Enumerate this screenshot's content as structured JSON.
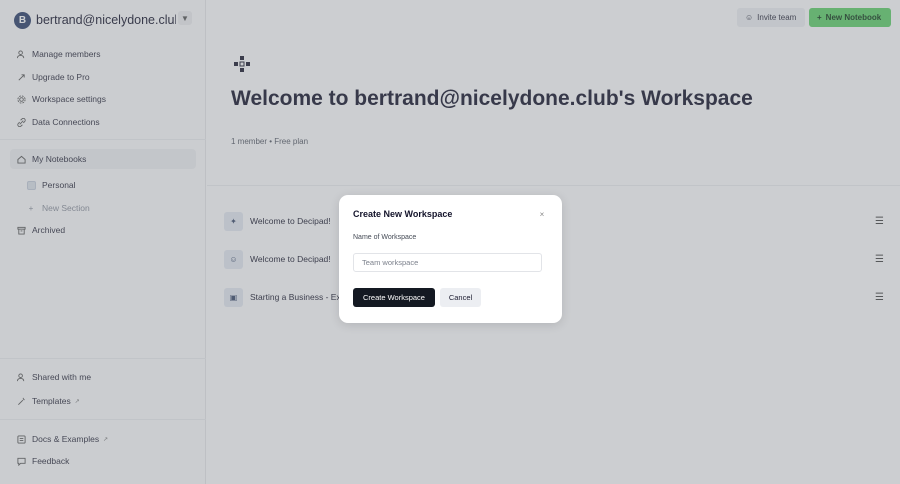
{
  "workspace": {
    "avatar_letter": "B",
    "name": "bertrand@nicelydone.club's ..."
  },
  "sidebar": {
    "top_items": [
      {
        "label": "Manage members",
        "icon": "users-icon"
      },
      {
        "label": "Upgrade to Pro",
        "icon": "rocket-icon"
      },
      {
        "label": "Workspace settings",
        "icon": "gear-icon"
      },
      {
        "label": "Data Connections",
        "icon": "link-icon"
      }
    ],
    "my_notebooks": "My Notebooks",
    "sections": [
      {
        "label": "Personal"
      },
      {
        "label": "New Section"
      }
    ],
    "archived": "Archived",
    "bottom_items": [
      {
        "label": "Shared with me",
        "icon": "users-icon"
      },
      {
        "label": "Templates",
        "icon": "wand-icon",
        "external": "↗"
      }
    ],
    "footer_items": [
      {
        "label": "Docs & Examples",
        "icon": "book-icon",
        "external": "↗"
      },
      {
        "label": "Feedback",
        "icon": "chat-icon"
      }
    ]
  },
  "header": {
    "invite_label": "Invite team",
    "new_notebook_label": "New Notebook"
  },
  "hero": {
    "title": "Welcome to bertrand@nicelydone.club's Workspace",
    "subtitle": "1 member • Free plan"
  },
  "notebooks": [
    {
      "title": "Welcome to Decipad!",
      "icon": "✦"
    },
    {
      "title": "Welcome to Decipad!",
      "icon": "☺"
    },
    {
      "title": "Starting a Business - Ex",
      "icon": "▣"
    }
  ],
  "modal": {
    "title": "Create New Workspace",
    "close": "×",
    "field_label": "Name of Workspace",
    "placeholder": "Team workspace",
    "create_label": "Create Workspace",
    "cancel_label": "Cancel"
  },
  "colors": {
    "accent_green": "#5fcf6a",
    "primary_dark": "#141922",
    "avatar_bg": "#2d3f6b"
  }
}
